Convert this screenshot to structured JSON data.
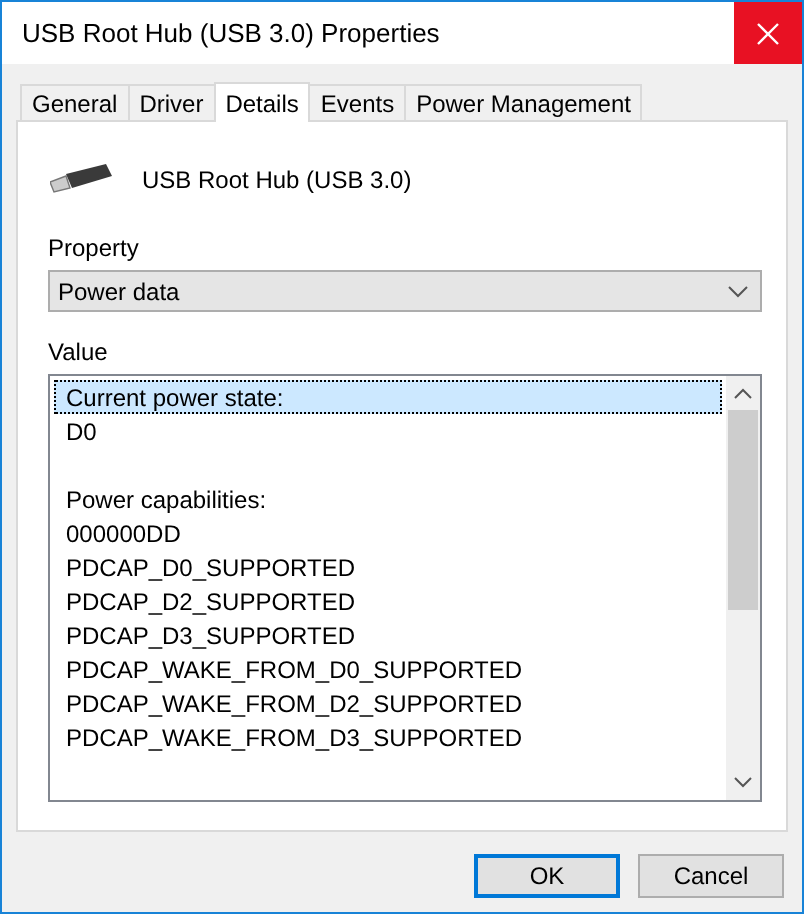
{
  "window": {
    "title": "USB Root Hub (USB 3.0) Properties"
  },
  "tabs": [
    {
      "label": "General",
      "selected": false
    },
    {
      "label": "Driver",
      "selected": false
    },
    {
      "label": "Details",
      "selected": true
    },
    {
      "label": "Events",
      "selected": false
    },
    {
      "label": "Power Management",
      "selected": false
    }
  ],
  "device": {
    "name": "USB Root Hub (USB 3.0)"
  },
  "property": {
    "label": "Property",
    "value": "Power data"
  },
  "value": {
    "label": "Value",
    "groups": [
      {
        "lines": [
          {
            "text": "Current power state:",
            "selected": true
          },
          {
            "text": "D0",
            "selected": false
          }
        ]
      },
      {
        "lines": [
          {
            "text": "Power capabilities:",
            "selected": false
          },
          {
            "text": "000000DD",
            "selected": false
          },
          {
            "text": "PDCAP_D0_SUPPORTED",
            "selected": false
          },
          {
            "text": "PDCAP_D2_SUPPORTED",
            "selected": false
          },
          {
            "text": "PDCAP_D3_SUPPORTED",
            "selected": false
          },
          {
            "text": "PDCAP_WAKE_FROM_D0_SUPPORTED",
            "selected": false
          },
          {
            "text": "PDCAP_WAKE_FROM_D2_SUPPORTED",
            "selected": false
          },
          {
            "text": "PDCAP_WAKE_FROM_D3_SUPPORTED",
            "selected": false
          }
        ]
      }
    ]
  },
  "buttons": [
    {
      "label": "OK",
      "default": true
    },
    {
      "label": "Cancel",
      "default": false
    }
  ]
}
